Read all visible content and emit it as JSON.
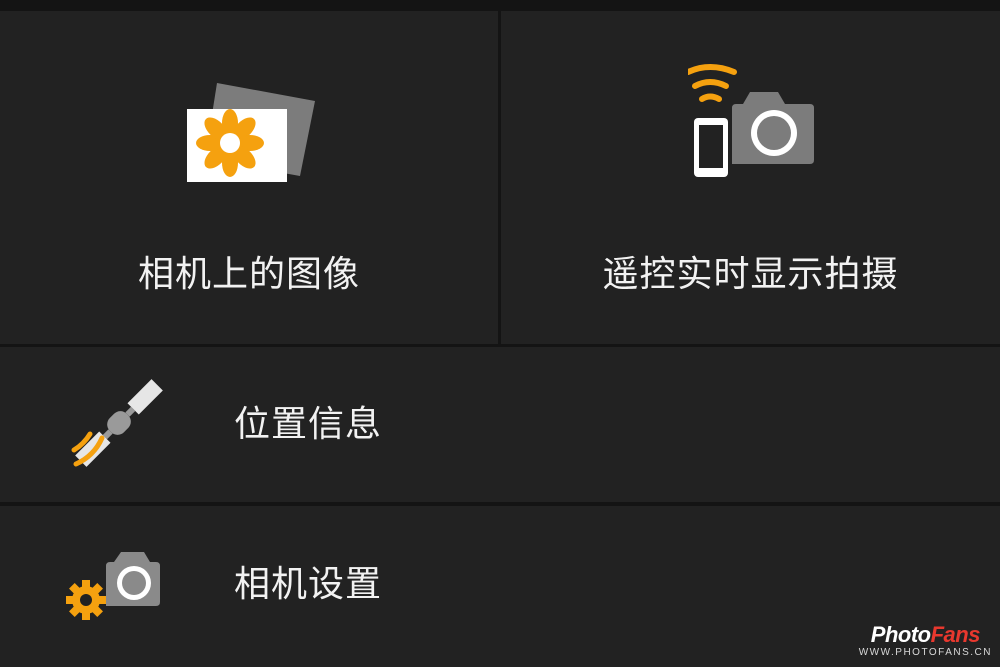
{
  "menu": {
    "images_on_camera": {
      "label": "相机上的图像",
      "icon": "gallery-icon"
    },
    "remote_live_view": {
      "label": "遥控实时显示拍摄",
      "icon": "smartphone-camera-wifi-icon"
    },
    "location_info": {
      "label": "位置信息",
      "icon": "satellite-icon"
    },
    "camera_settings": {
      "label": "相机设置",
      "icon": "camera-gear-icon"
    }
  },
  "watermark": {
    "logo_prefix": "Photo",
    "logo_accent": "Fans",
    "url": "WWW.PHOTOFANS.CN"
  },
  "colors": {
    "background": "#141414",
    "tile": "#222222",
    "text": "#f2f2f2",
    "accent_orange": "#f5a10f",
    "icon_gray": "#8a8a8a",
    "watermark_red": "#e8382e"
  }
}
